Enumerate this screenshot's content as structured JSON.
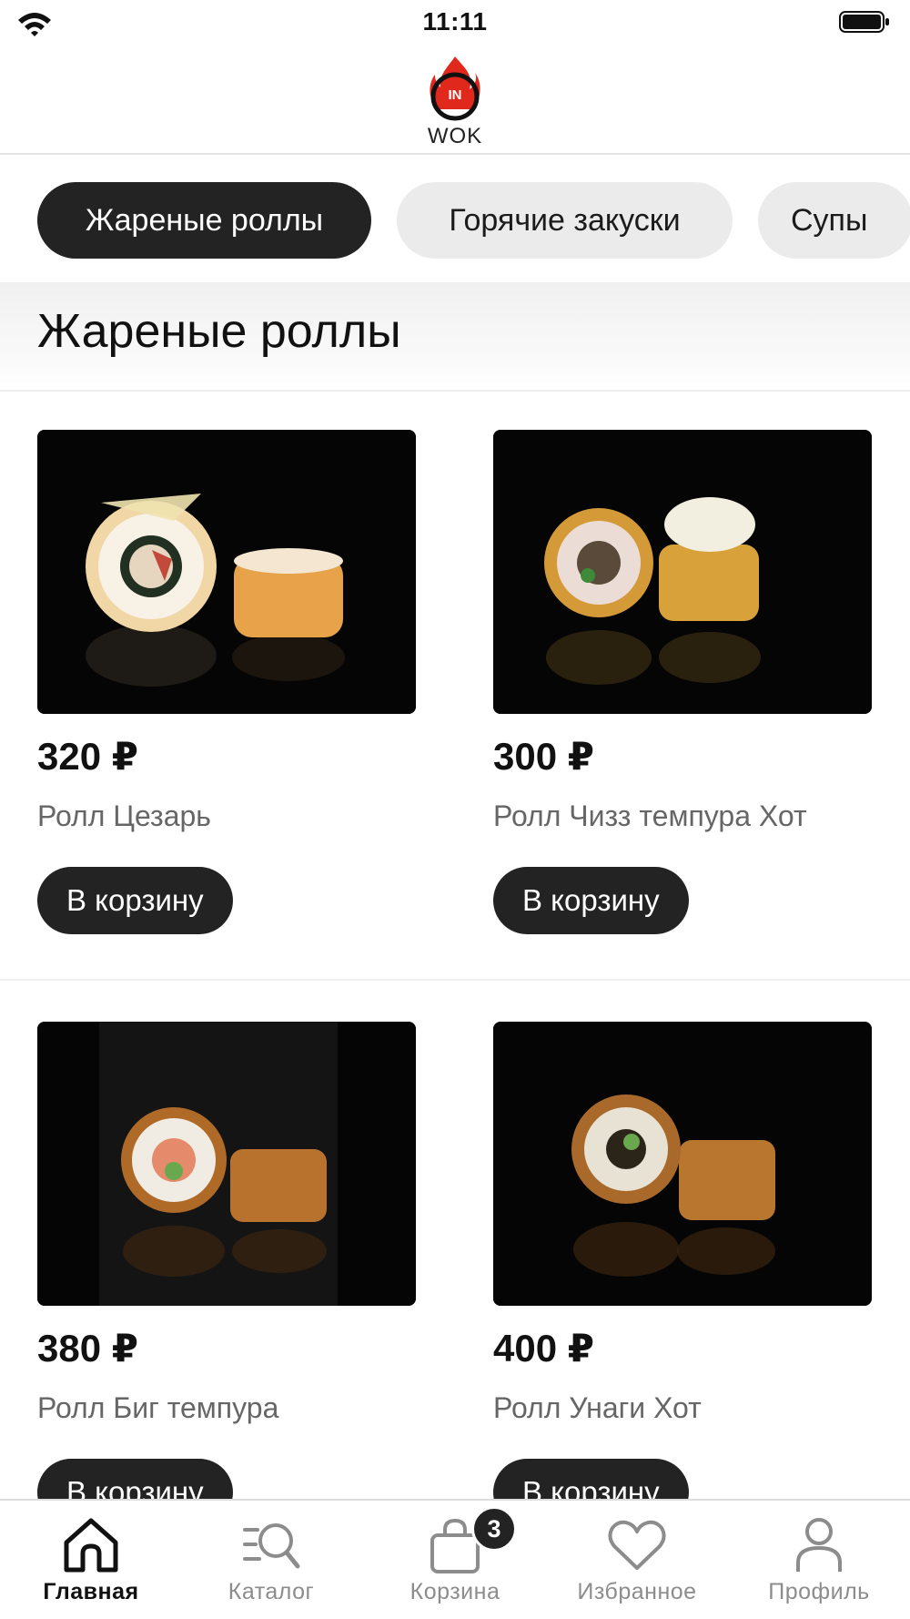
{
  "status_bar": {
    "time": "11:11",
    "wifi_icon": "wifi-icon",
    "battery_icon": "battery-icon"
  },
  "header": {
    "logo_badge": "IN",
    "logo_text": "WOK"
  },
  "categories": [
    {
      "label": "Жареные роллы",
      "active": true
    },
    {
      "label": "Горячие закуски",
      "active": false
    },
    {
      "label": "Супы",
      "active": false
    }
  ],
  "section": {
    "title": "Жареные роллы"
  },
  "products": [
    {
      "price": "320 ₽",
      "name": "Ролл Цезарь",
      "button": "В корзину",
      "image_icon": "sushi-roll-photo"
    },
    {
      "price": "300 ₽",
      "name": "Ролл Чизз темпура Хот",
      "button": "В корзину",
      "image_icon": "sushi-roll-photo"
    },
    {
      "price": "380 ₽",
      "name": "Ролл Биг темпура",
      "button": "В корзину",
      "image_icon": "sushi-roll-photo"
    },
    {
      "price": "400 ₽",
      "name": "Ролл Унаги Хот",
      "button": "В корзину",
      "image_icon": "sushi-roll-photo"
    }
  ],
  "tabbar": {
    "items": [
      {
        "label": "Главная",
        "icon": "home-icon",
        "active": true
      },
      {
        "label": "Каталог",
        "icon": "catalog-search-icon",
        "active": false
      },
      {
        "label": "Корзина",
        "icon": "cart-bag-icon",
        "active": false,
        "badge": "3"
      },
      {
        "label": "Избранное",
        "icon": "heart-icon",
        "active": false
      },
      {
        "label": "Профиль",
        "icon": "profile-icon",
        "active": false
      }
    ]
  },
  "colors": {
    "dark": "#232323",
    "chip_bg": "#ebebeb",
    "muted_text": "#666666",
    "tab_inactive": "#8c8c8c",
    "logo_red": "#e0281c"
  }
}
